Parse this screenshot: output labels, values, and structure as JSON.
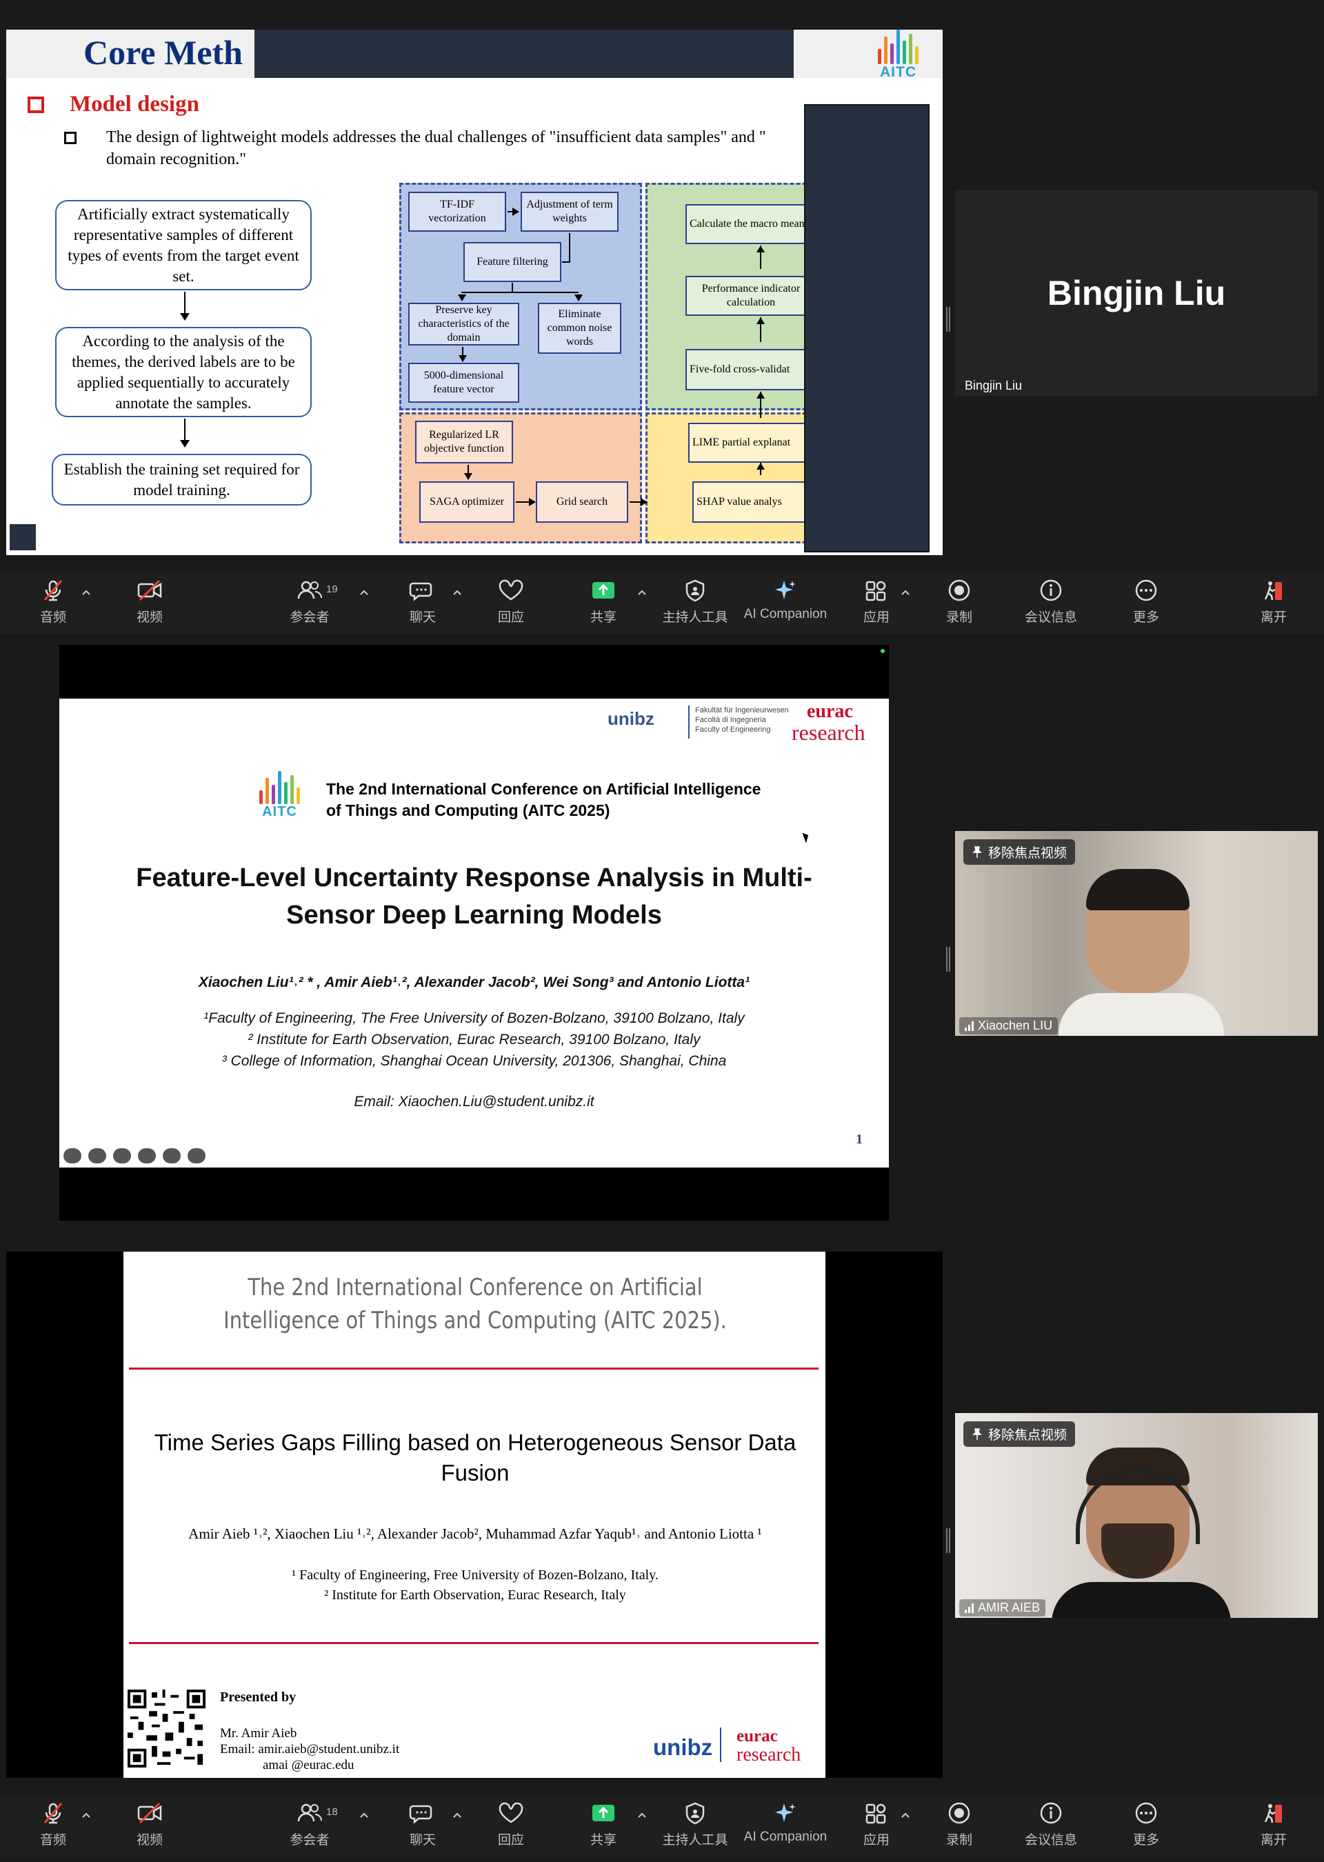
{
  "share1": {
    "title": "Core Meth",
    "logo_text": "AITC",
    "section": "Model design",
    "bullet": "The design of lightweight models addresses the dual challenges of \"insufficient data samples\" and \"",
    "bullet_cont": "domain recognition.\"",
    "left_steps": [
      "Artificially extract systematically representative samples of different types of events from the target event set.",
      "According to the analysis of the themes, the derived labels are to be applied sequentially to accurately annotate the samples.",
      "Establish the training set required for model training."
    ],
    "flow": {
      "tfidf": "TF-IDF vectorization",
      "adjust": "Adjustment of term weights",
      "filter": "Feature filtering",
      "preserve": "Preserve key characteristics of the domain",
      "eliminate": "Eliminate common noise words",
      "vector": "5000-dimensional feature vector",
      "lr": "Regularized LR objective function",
      "saga": "SAGA optimizer",
      "grid": "Grid search",
      "macro": "Calculate the macro mean",
      "perf": "Performance indicator calculation",
      "fivefold": "Five-fold cross-validat",
      "lime": "LIME partial explanat",
      "shap": "SHAP value analys"
    },
    "colors": {
      "title": "#0d2f7a",
      "accent": "#d41d1d",
      "blue_region": "#b4c6e7",
      "green_region": "#c5e0b4",
      "orange_region": "#f8cbad",
      "yellow_region": "#ffe699"
    }
  },
  "tiles": {
    "bingjin": {
      "big_name": "Bingjin Liu",
      "label": "Bingjin Liu"
    },
    "xiaochen": {
      "pin": "移除焦点视频",
      "label": "Xiaochen LIU"
    },
    "amir": {
      "pin": "移除焦点视频",
      "label": "AMIR AIEB"
    }
  },
  "toolbar1": {
    "audio": "音频",
    "video": "视频",
    "participants": "参会者",
    "participants_count": "19",
    "chat": "聊天",
    "react": "回应",
    "share": "共享",
    "host_tools": "主持人工具",
    "ai": "AI Companion",
    "apps": "应用",
    "record": "录制",
    "info": "会议信息",
    "more": "更多",
    "leave": "离开"
  },
  "toolbar2": {
    "audio": "音频",
    "video": "视频",
    "participants": "参会者",
    "participants_count": "18",
    "chat": "聊天",
    "react": "回应",
    "share": "共享",
    "host_tools": "主持人工具",
    "ai": "AI Companion",
    "apps": "应用",
    "record": "录制",
    "info": "会议信息",
    "more": "更多",
    "leave": "离开"
  },
  "share2": {
    "unibz": "unibz",
    "faculty": [
      "Fakultät für Ingenieurwesen",
      "Facoltà di Ingegneria",
      "Faculty of Engineering"
    ],
    "eurac1": "eurac",
    "eurac2": "research",
    "logo_text": "AITC",
    "conference": "The 2nd International Conference on Artificial Intelligence of Things and Computing (AITC 2025)",
    "title": "Feature-Level Uncertainty Response Analysis in Multi-Sensor Deep Learning Models",
    "authors": "Xiaochen Liu¹˒² * , Amir Aieb¹˒², Alexander Jacob², Wei Song³ and Antonio Liotta¹",
    "affiliations": [
      "¹Faculty of Engineering, The Free University of Bozen-Bolzano, 39100 Bolzano, Italy",
      "² Institute for Earth Observation, Eurac Research, 39100 Bolzano, Italy",
      "³ College of Information, Shanghai Ocean University, 201306, Shanghai, China"
    ],
    "email": "Email: Xiaochen.Liu@student.unibz.it",
    "page": "1"
  },
  "share3": {
    "conference": "The 2nd International Conference on Artificial Intelligence of Things and Computing (AITC 2025).",
    "title": "Time Series Gaps Filling based on Heterogeneous Sensor Data Fusion",
    "authors": "Amir Aieb ¹˒², Xiaochen Liu ¹˒², Alexander Jacob², Muhammad Azfar Yaqub¹˒ and Antonio Liotta ¹",
    "affiliations": [
      "¹ Faculty of Engineering, Free University of Bozen-Bolzano, Italy.",
      "² Institute for Earth Observation, Eurac Research, Italy"
    ],
    "presented_by": "Presented by",
    "presenter": "Mr. Amir Aieb",
    "email1": "Email: amir.aieb@student.unibz.it",
    "email2": "amai   @eurac.edu",
    "unibz": "unibz",
    "eurac1": "eurac",
    "eurac2": "research"
  }
}
